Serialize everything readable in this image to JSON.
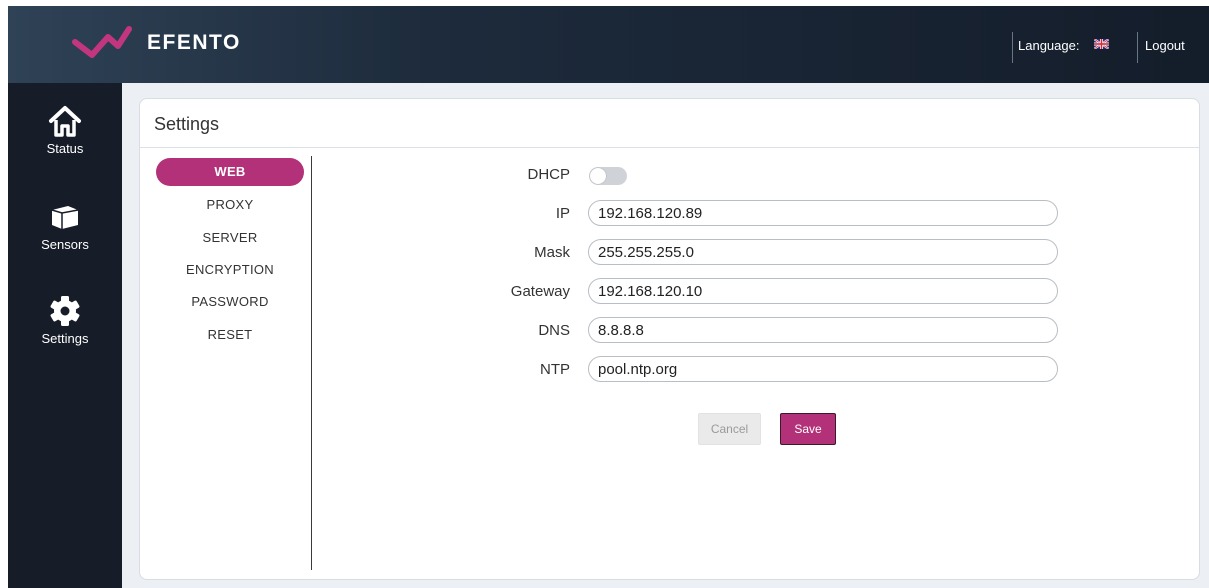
{
  "brand": {
    "name": "EFENTO",
    "accent": "#b23178"
  },
  "header": {
    "language_label": "Language:",
    "language_flag": "uk-flag-icon",
    "logout_label": "Logout"
  },
  "sidebar": {
    "items": [
      {
        "label": "Status",
        "icon": "home-icon"
      },
      {
        "label": "Sensors",
        "icon": "sensor-box-icon"
      },
      {
        "label": "Settings",
        "icon": "gear-icon"
      }
    ]
  },
  "settings": {
    "title": "Settings",
    "tabs": [
      {
        "label": "WEB",
        "active": true
      },
      {
        "label": "PROXY",
        "active": false
      },
      {
        "label": "SERVER",
        "active": false
      },
      {
        "label": "ENCRYPTION",
        "active": false
      },
      {
        "label": "PASSWORD",
        "active": false
      },
      {
        "label": "RESET",
        "active": false
      }
    ],
    "form": {
      "dhcp_label": "DHCP",
      "dhcp_enabled": false,
      "ip_label": "IP",
      "ip_value": "192.168.120.89",
      "mask_label": "Mask",
      "mask_value": "255.255.255.0",
      "gateway_label": "Gateway",
      "gateway_value": "192.168.120.10",
      "dns_label": "DNS",
      "dns_value": "8.8.8.8",
      "ntp_label": "NTP",
      "ntp_value": "pool.ntp.org",
      "cancel_label": "Cancel",
      "save_label": "Save"
    }
  }
}
